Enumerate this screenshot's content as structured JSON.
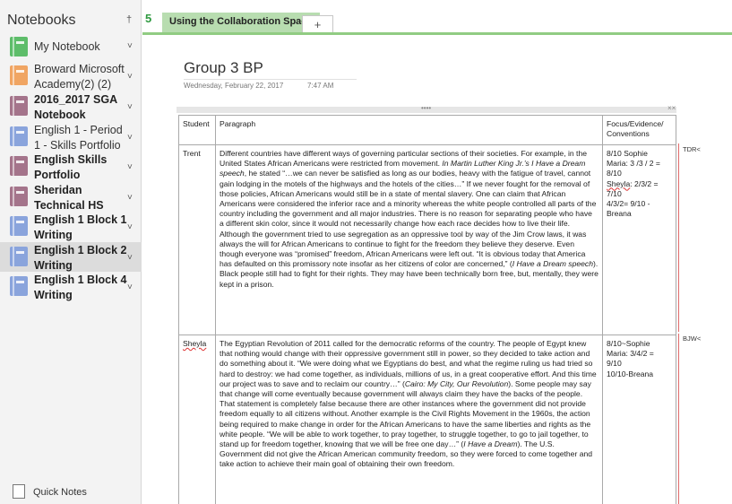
{
  "sidebar": {
    "title": "Notebooks",
    "pin_glyph": "†",
    "items": [
      {
        "label": "My Notebook",
        "color": "#5ebd6a",
        "bold": false
      },
      {
        "label": "Broward Microsoft Academy(2) (2)",
        "color": "#f0a563",
        "bold": false
      },
      {
        "label": "2016_2017 SGA Notebook",
        "color": "#a4748b",
        "bold": true
      },
      {
        "label": "English 1 - Period 1 - Skills Portfolio",
        "color": "#8aa4dc",
        "bold": false
      },
      {
        "label": "English Skills Portfolio",
        "color": "#a4748b",
        "bold": true
      },
      {
        "label": "Sheridan Technical HS",
        "color": "#a4748b",
        "bold": true
      },
      {
        "label": "English 1 Block 1 Writing",
        "color": "#8aa4dc",
        "bold": true
      },
      {
        "label": "English 1 Block 2 Writing",
        "color": "#8aa4dc",
        "bold": true
      },
      {
        "label": "English 1 Block 4 Writing",
        "color": "#8aa4dc",
        "bold": true
      }
    ],
    "chevron": "˅",
    "quick_notes": "Quick Notes"
  },
  "tabs": {
    "back_glyph": "5",
    "active": "Using the Collaboration Space",
    "new": "+"
  },
  "page": {
    "title": "Group 3 BP",
    "date": "Wednesday, February 22, 2017",
    "time": "7:47 AM"
  },
  "table": {
    "handle_dots": "••••",
    "handle_x": "××",
    "headers": [
      "Student",
      "Paragraph",
      "Focus/Evidence/ Conventions"
    ],
    "rows": [
      {
        "student": "Trent",
        "paragraph_parts": [
          "Different countries have different ways of governing particular sections of their societies. For example, in the United States African Americans were restricted from movement. ",
          "In Martin Luther King Jr.’s I Have a Dream speech",
          ", he stated “…we can never be satisfied as long as our bodies, heavy with the fatigue of travel, cannot gain lodging in the motels of the highways and the hotels of the cities…” If we never fought for the removal of those policies, African Americans would still be in a state of mental slavery. One can claim that African Americans were considered the inferior race and a minority whereas the white people controlled all parts of the country including the government and all major industries. There is no reason for separating people who have a different skin color, since it would not necessarily change how each race decides how to live their life. Although the government tried to use segregation as an oppressive tool by way of the Jim Crow laws, it was always the will for African Americans to continue to fight for the freedom they believe they deserve. Even though everyone was “promised” freedom, African Americans were left out. “It is obvious today that America has defaulted on this promissory note insofar as her citizens of color are concerned,” (",
          "I Have a Dream speech",
          "). Black people still had to fight for their rights. They may have been technically born free, but, mentally, they were kept in a prison."
        ],
        "focus_lines": [
          "8/10 Sophie",
          "Maria:  3 /3 / 2 =",
          "8/10",
          "Sheyla",
          ": 2/3/2  =",
          "7/10",
          "4/3/2= 9/10 -",
          "Breana"
        ]
      },
      {
        "student": "Sheyla",
        "paragraph_parts": [
          "The Egyptian Revolution of 2011 called for the democratic reforms of the country. The people of Egypt knew that nothing would change with their oppressive government still in power, so they decided to take action and do something about it. “We were doing what we Egyptians do best, and what the regime ruling us had tried so hard to destroy: we had come together, as individuals, millions of us, in a great cooperative effort. And this time our project was to save and to reclaim our country…” (",
          "Cairo: My City, Our Revolution",
          "). Some people may say that change will come eventually because government will always claim they have the backs of the people. That statement is completely false because there are other instances where the government did not provide freedom equally to all citizens without. Another example is the Civil Rights Movement in the 1960s, the action being required to make change in order for the African Americans to have the same liberties and rights as the white people. “We will be able to work together, to pray together, to struggle together, to go to jail together, to stand up for freedom together, knowing that we will be free one day…” (",
          "I Have a Dream",
          "). The U.S. Government did not give the African American community freedom, so they were forced to come together and take action to achieve their main goal of obtaining their own freedom."
        ],
        "focus_lines": [
          "8/10~Sophie",
          "Maria: 3/4/2 =",
          "9/10",
          "10/10-Breana"
        ]
      }
    ]
  },
  "side_notes": [
    "TDR<",
    "BJW<"
  ],
  "colors": {
    "accent": "#91cc83",
    "tab_active": "#b8ddb0",
    "note_bar": "#e06b6b"
  }
}
